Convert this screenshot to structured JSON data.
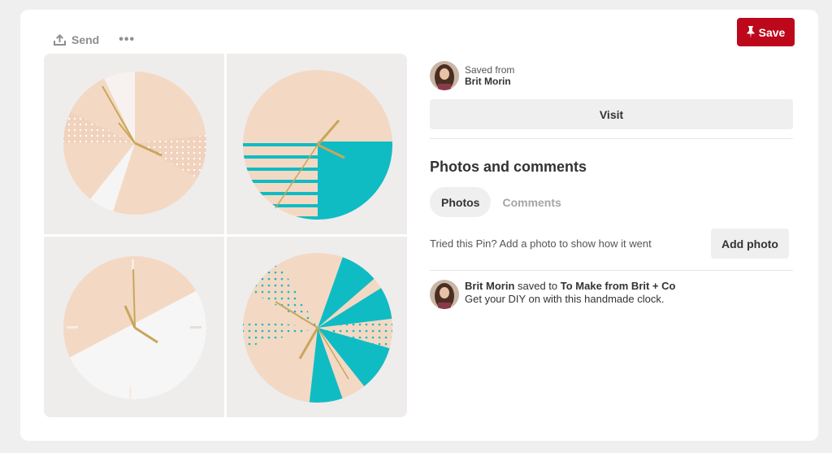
{
  "toolbar": {
    "send_label": "Send",
    "more_label": "•••",
    "save_label": "Save"
  },
  "pin": {
    "saved_from_label": "Saved from",
    "saved_from_name": "Brit Morin",
    "visit_label": "Visit"
  },
  "photos_comments": {
    "title": "Photos and comments",
    "tabs": [
      {
        "label": "Photos",
        "active": true
      },
      {
        "label": "Comments",
        "active": false
      }
    ],
    "prompt": "Tried this Pin? Add a photo to show how it went",
    "add_photo_label": "Add photo"
  },
  "activity": {
    "user": "Brit Morin",
    "action": " saved to ",
    "board": "To Make from Brit + Co",
    "description": "Get your DIY on with this handmade clock."
  },
  "colors": {
    "brand_red": "#bd081c",
    "teal": "#0fbcc4",
    "wood": "#f3d9c4"
  },
  "icons": {
    "send": "upload-icon",
    "save": "pushpin-icon",
    "expand": "expand-icon"
  }
}
